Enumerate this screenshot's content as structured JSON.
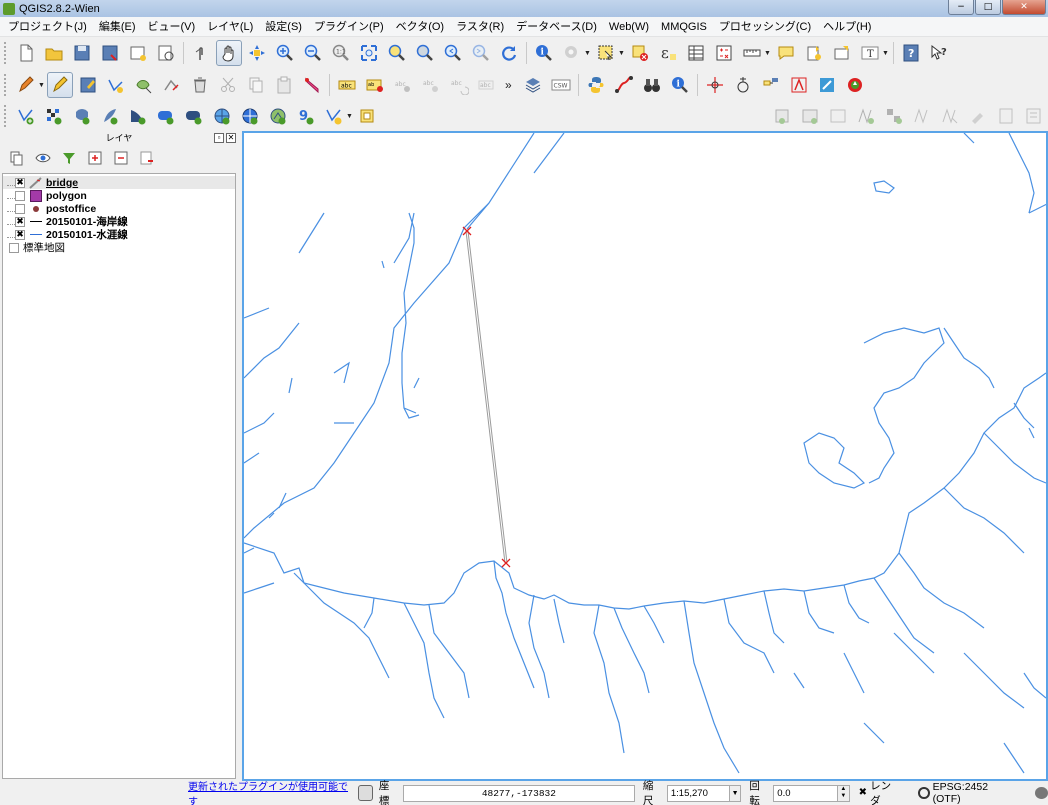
{
  "window": {
    "title": "QGIS2.8.2-Wien",
    "minimize": "−",
    "maximize": "□",
    "close": "✕"
  },
  "menu": [
    "プロジェクト(J)",
    "編集(E)",
    "ビュー(V)",
    "レイヤ(L)",
    "設定(S)",
    "プラグイン(P)",
    "ベクタ(O)",
    "ラスタ(R)",
    "データベース(D)",
    "Web(W)",
    "MMQGIS",
    "プロセッシング(C)",
    "ヘルプ(H)"
  ],
  "toolbar2": {
    "more": "»",
    "csw": "CSW"
  },
  "layers_panel": {
    "title": "レイヤ",
    "layers": [
      {
        "name": "bridge",
        "checked": "✖",
        "symbol": "line-edit-icon"
      },
      {
        "name": "polygon",
        "checked": "",
        "symbol": "polygon-fill",
        "color": "#a33aa8"
      },
      {
        "name": "postoffice",
        "checked": "",
        "symbol": "point",
        "color": "#8b3a3a"
      },
      {
        "name": "20150101-海岸線",
        "checked": "✖",
        "symbol": "line",
        "color": "#000000"
      },
      {
        "name": "20150101-水涯線",
        "checked": "✖",
        "symbol": "line",
        "color": "#2f6fd6"
      }
    ],
    "group": {
      "name": "標準地図",
      "checked": ""
    }
  },
  "map": {
    "line_color": "#4a90e2",
    "bridge_color": "#9a9a9a",
    "vertex_color": "#e02020"
  },
  "status": {
    "plugin_notice": "更新されたプラグインが使用可能です",
    "coord_label": "座標",
    "coord_value": "48277,-173832",
    "scale_label": "縮尺",
    "scale_value": "1:15,270",
    "rotation_label": "回転",
    "rotation_value": "0.0",
    "render_checked": "✖",
    "render_label": "レンダ",
    "crs": "EPSG:2452 (OTF)"
  }
}
